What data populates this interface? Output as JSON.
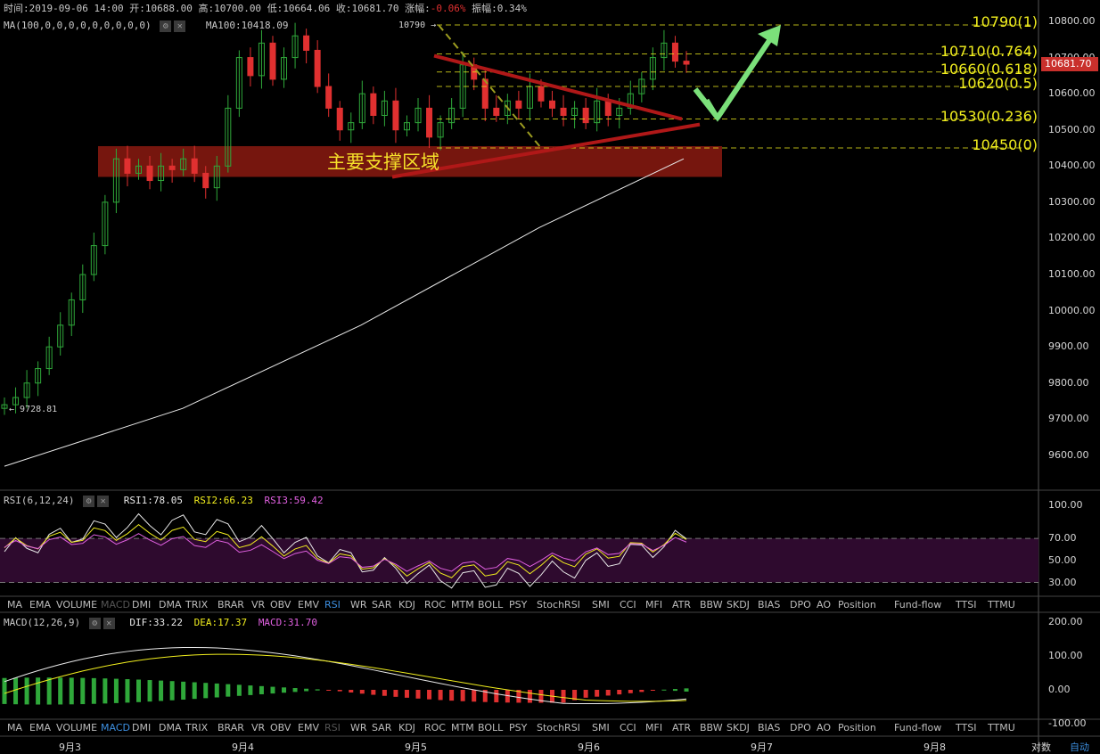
{
  "header": {
    "time_label": "时间:",
    "time": "2019-09-06 14:00",
    "open_label": "开:",
    "open": "10688.00",
    "high_label": "高:",
    "high": "10700.00",
    "low_label": "低:",
    "low": "10664.06",
    "close_label": "收:",
    "close": "10681.70",
    "change_label": "涨幅:",
    "change": "-0.06%",
    "amplitude_label": "振幅:",
    "amplitude": "0.34%",
    "ma_settings": "MA(100,0,0,0,0,0,0,0,0,0)",
    "ma_value": "MA100:10418.09"
  },
  "rsi_header": {
    "label": "RSI(6,12,24)",
    "rsi1": "RSI1:78.05",
    "rsi2": "RSI2:66.23",
    "rsi3": "RSI3:59.42"
  },
  "macd_header": {
    "label": "MACD(12,26,9)",
    "dif": "DIF:33.22",
    "dea": "DEA:17.37",
    "macd": "MACD:31.70"
  },
  "indicator_tabs": [
    "MA",
    "EMA",
    "VOLUME",
    "MACD",
    "DMI",
    "DMA",
    "TRIX",
    "BRAR",
    "VR",
    "OBV",
    "EMV",
    "RSI",
    "WR",
    "SAR",
    "KDJ",
    "ROC",
    "MTM",
    "BOLL",
    "PSY",
    "StochRSI",
    "SMI",
    "CCI",
    "MFI",
    "ATR",
    "BBW",
    "SKDJ",
    "BIAS",
    "DPO",
    "AO",
    "Position",
    "Fund-flow",
    "TTSI",
    "TTMU"
  ],
  "tabs_rsi_state": {
    "disabled": "MACD",
    "active": "RSI"
  },
  "tabs_macd_state": {
    "disabled": "RSI",
    "active": "MACD"
  },
  "price_axis": [
    "10800.00",
    "10700.00",
    "10600.00",
    "10500.00",
    "10400.00",
    "10300.00",
    "10200.00",
    "10100.00",
    "10000.00",
    "9900.00",
    "9800.00",
    "9700.00",
    "9600.00"
  ],
  "current_price_tag": "10681.70",
  "rsi_axis": [
    "100.00",
    "70.00",
    "50.00",
    "30.00"
  ],
  "macd_axis": [
    "200.00",
    "100.00",
    "0.00",
    "-100.00"
  ],
  "date_axis": [
    "9月3",
    "9月4",
    "9月5",
    "9月6",
    "9月7",
    "9月8"
  ],
  "footer": {
    "log_label": "对数",
    "auto_label": "自动"
  },
  "annotations": {
    "support_zone": "主要支撑区域",
    "high_marker": "10790",
    "low_marker": "9728.81"
  },
  "fib_levels": [
    {
      "label": "10790(1)",
      "price": 10790
    },
    {
      "label": "10710(0.764)",
      "price": 10710
    },
    {
      "label": "10660(0.618)",
      "price": 10660
    },
    {
      "label": "10620(0.5)",
      "price": 10620
    },
    {
      "label": "10530(0.236)",
      "price": 10530
    },
    {
      "label": "10450(0)",
      "price": 10450
    }
  ],
  "colors": {
    "up": "#2fa83a",
    "down": "#e03030",
    "fib": "#f1ee1e",
    "zone": "#8b1a10",
    "arrow": "#7be07a",
    "rsi_band": "#2e0a2e",
    "ma_line": "#e8e8e8"
  },
  "chart_data": {
    "type": "candlestick",
    "x_ticks": [
      "9月3",
      "9月4",
      "9月5",
      "9月6",
      "9月7",
      "9月8"
    ],
    "y_range": [
      9550,
      10850
    ],
    "support_zone": [
      10370,
      10455
    ],
    "ma100": [
      [
        0,
        9570
      ],
      [
        100,
        9730
      ],
      [
        200,
        9960
      ],
      [
        300,
        10230
      ],
      [
        381,
        10420
      ]
    ],
    "candles_approx_close": [
      9740,
      9760,
      9800,
      9840,
      9900,
      9960,
      10030,
      10100,
      10180,
      10300,
      10420,
      10380,
      10400,
      10360,
      10400,
      10390,
      10420,
      10380,
      10340,
      10400,
      10560,
      10700,
      10650,
      10740,
      10640,
      10700,
      10760,
      10720,
      10620,
      10560,
      10500,
      10520,
      10600,
      10540,
      10580,
      10500,
      10520,
      10560,
      10480,
      10520,
      10560,
      10680,
      10640,
      10560,
      10540,
      10580,
      10560,
      10620,
      10580,
      10560,
      10540,
      10560,
      10520,
      10580,
      10540,
      10560,
      10600,
      10640,
      10700,
      10740,
      10690,
      10681.7
    ],
    "rsi": {
      "rsi1": 78.05,
      "rsi2": 66.23,
      "rsi3": 59.42,
      "overbought": 70,
      "oversold": 30
    },
    "macd": {
      "dif": 33.22,
      "dea": 17.37,
      "macd": 31.7
    }
  }
}
